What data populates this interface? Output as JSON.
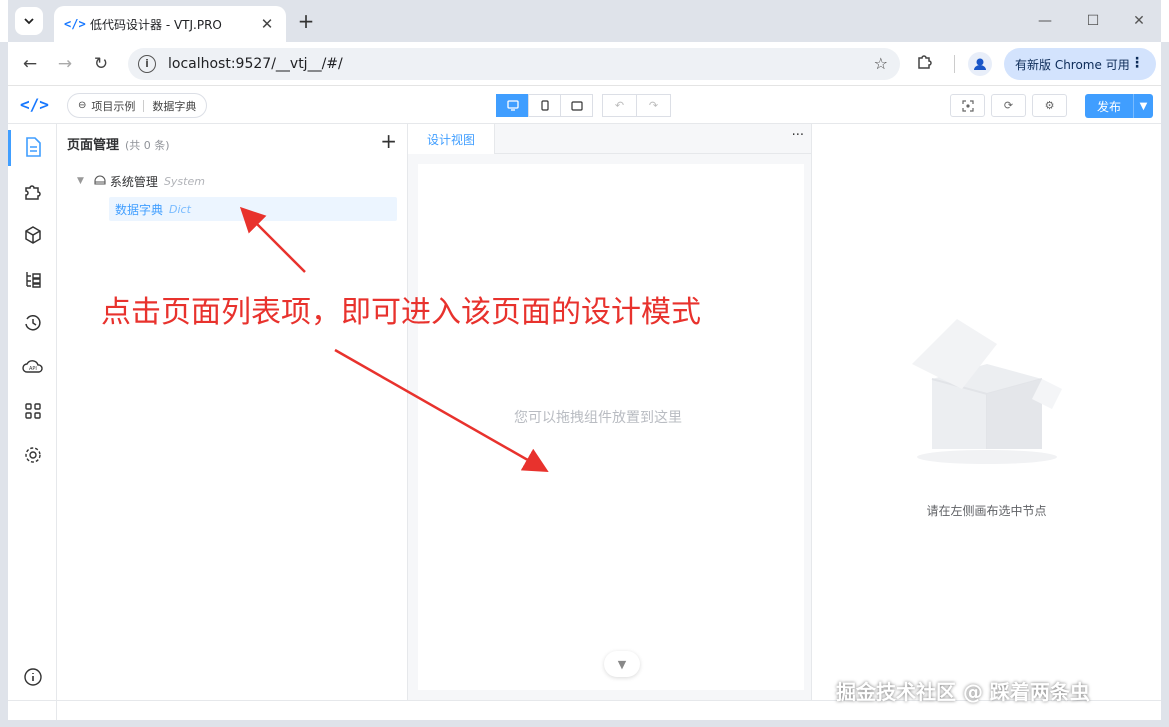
{
  "browser": {
    "tab_title": "低代码设计器 - VTJ.PRO",
    "tab_logo": "</>",
    "url": "localhost:9527/__vtj__/#/",
    "update_label": "有新版 Chrome 可用"
  },
  "app": {
    "brand": "</>",
    "breadcrumb": {
      "project": "项目示例",
      "page": "数据字典"
    },
    "publish_label": "发布"
  },
  "pages_panel": {
    "title": "页面管理",
    "count": "(共 0 条)",
    "tree": [
      {
        "label": "系统管理",
        "en": "System"
      },
      {
        "label": "数据字典",
        "en": "Dict",
        "selected": true
      }
    ]
  },
  "canvas": {
    "tab_label": "设计视图",
    "empty_hint": "您可以拖拽组件放置到这里"
  },
  "props_panel": {
    "empty_text": "请在左侧画布选中节点"
  },
  "annotation": {
    "text": "点击页面列表项，即可进入该页面的设计模式"
  },
  "watermark": "掘金技术社区 @ 踩着两条虫",
  "colors": {
    "accent": "#409eff",
    "annotation": "#e8322d"
  }
}
